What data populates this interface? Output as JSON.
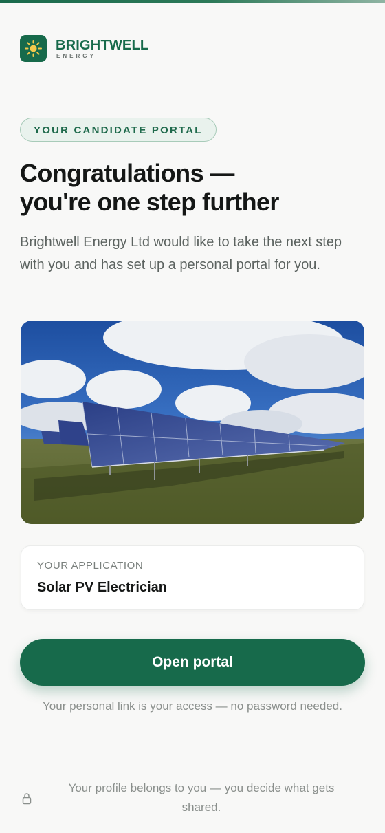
{
  "brand": {
    "name": "BRIGHTWELL",
    "sub": "ENERGY",
    "color": "#176a4b"
  },
  "badge": "YOUR CANDIDATE PORTAL",
  "headline": {
    "line1": "Congratulations —",
    "line2": "you're one step further"
  },
  "intro": "Brightwell Energy Ltd would like to take the next step with you and has set up a personal portal for you.",
  "hero_image": {
    "subject": "solar panel field under cloudy blue sky"
  },
  "application": {
    "label": "YOUR APPLICATION",
    "role": "Solar PV Electrician"
  },
  "cta": {
    "label": "Open portal",
    "note": "Your personal link is your access — no password needed."
  },
  "footer": {
    "icon": "lock-icon",
    "text": "Your profile belongs to you — you decide what gets shared."
  }
}
